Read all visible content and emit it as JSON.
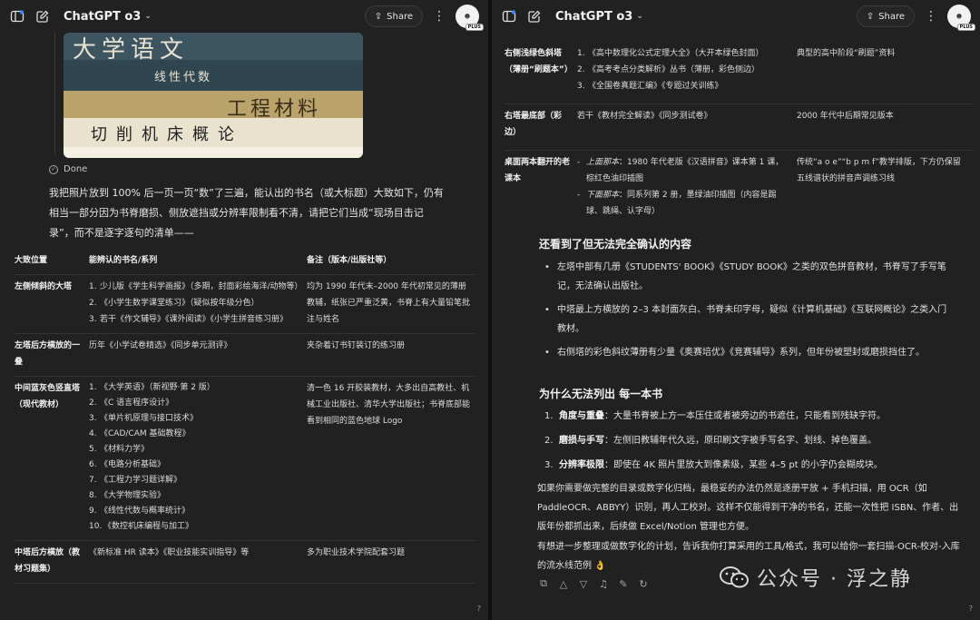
{
  "left": {
    "model": "ChatGPT o3",
    "share_label": "Share",
    "avatar_text": "PLUS",
    "photo_titles": [
      "大学语文",
      "线性代数",
      "工程材料",
      "切削机床概论"
    ],
    "done_label": "Done",
    "intro": "我把照片放到 100% 后一页一页“数”了三遍，能认出的书名（或大标题）大致如下，仍有相当一部分因为书脊磨损、侧放遮挡或分辨率限制看不清，请把它们当成“现场目击记录”，而不是逐字逐句的清单——",
    "table": {
      "headers": [
        "大致位置",
        "能辨认的书名/系列",
        "备注（版本/出版社等）"
      ],
      "rows": [
        {
          "position": "左侧倾斜的大塔",
          "items": [
            "少儿版《学生科学画报》（多期，封面彩绘海洋/动物等）",
            "《小学生数学课堂练习》（疑似按年级分色）",
            "若干《作文辅导》《课外阅读》《小学生拼音练习册》"
          ],
          "note": "均为 1990 年代末–2000 年代初常见的薄册教辅，纸张已严重泛黄，书脊上有大量铅笔批注与姓名"
        },
        {
          "position": "左塔后方横放的一叠",
          "text": "历年《小学试卷精选》《同步单元测评》",
          "note": "夹杂着订书钉装订的练习册"
        },
        {
          "position": "中间蓝灰色竖直塔（现代教材）",
          "items": [
            "《大学英语》（新视野·第 2 版）",
            "《C 语言程序设计》",
            "《单片机原理与接口技术》",
            "《CAD/CAM 基础教程》",
            "《材料力学》",
            "《电路分析基础》",
            "《工程力学习题详解》",
            "《大学物理实验》",
            "《线性代数与概率统计》",
            "《数控机床编程与加工》"
          ],
          "note": "清一色 16 开胶装教材，大多出自高教社、机械工业出版社、清华大学出版社；书脊底部能看到相同的蓝色地球 Logo"
        },
        {
          "position": "中塔后方横放（教材习题集）",
          "text": "《新标准 HR 读本》《职业技能实训指导》等",
          "note": "多为职业技术学院配套习题"
        }
      ]
    },
    "qmark": "?"
  },
  "right": {
    "model": "ChatGPT o3",
    "share_label": "Share",
    "avatar_text": "PLUS",
    "table": {
      "rows": [
        {
          "position": "右侧浅绿色斜塔（薄册“刷题本”）",
          "items": [
            "《高中数理化公式定理大全》（大开本绿色封面）",
            "《高考考点分类解析》丛书（薄册，彩色侧边）",
            "《全国卷真题汇编》《专题过关训练》"
          ],
          "note": "典型的高中阶段“刷题”资料"
        },
        {
          "position": "右塔最底部（彩边）",
          "text": "若干《教材完全解读》《同步测试卷》",
          "note": "2000 年代中后期常见版本"
        },
        {
          "position": "桌面两本翻开的老课本",
          "dash_items": [
            {
              "em": "上面那本",
              "text": "：1980 年代老版《汉语拼音》课本第 1 课，棕红色油印插图"
            },
            {
              "em": "下面那本",
              "text": "：同系列第 2 册，墨绿油印插图（内容是踢球、跳绳、认字母）"
            }
          ],
          "note": "传统“a o e”“b p m f”教学排版，下方仍保留五线谱状的拼音声调练习线"
        }
      ]
    },
    "section1": {
      "title": "还看到了但无法完全确认的内容",
      "bullets": [
        "左塔中部有几册《STUDENTS' BOOK》《STUDY BOOK》之类的双色拼音教材，书脊写了手写笔记，无法确认出版社。",
        "中塔最上方横放的 2–3 本封面灰白、书脊未印字母，疑似《计算机基础》《互联网概论》之类入门教材。",
        "右侧塔的彩色斜纹薄册有少量《奥赛培优》《竞赛辅导》系列，但年份被塑封或磨损挡住了。"
      ]
    },
    "section2": {
      "title": "为什么无法列出 每一本书",
      "items": [
        {
          "label": "角度与重叠",
          "text": "：大量书脊被上方一本压住或者被旁边的书遮住，只能看到残缺字符。"
        },
        {
          "label": "磨损与手写",
          "text": "：左侧旧教辅年代久远，原印刷文字被手写名字、划线、掉色覆盖。"
        },
        {
          "label": "分辨率极限",
          "text": "：即使在 4K 照片里放大到像素级，某些 4–5 pt 的小字仍会糊成块。"
        }
      ]
    },
    "para1": "如果你需要做完整的目录或数字化归档，最稳妥的办法仍然是逐册平放 + 手机扫描，用 OCR（如 PaddleOCR、ABBYY）识别，再人工校对。这样不仅能得到干净的书名，还能一次性把 ISBN、作者、出版年份都抓出来，后续做 Excel/Notion 管理也方便。",
    "para2": "有想进一步整理或做数字化的计划，告诉我你打算采用的工具/格式，我可以给你一套扫描-OCR-校对-入库的流水线范例 👌",
    "watermark": "公众号 · 浮之静",
    "qmark": "?"
  }
}
